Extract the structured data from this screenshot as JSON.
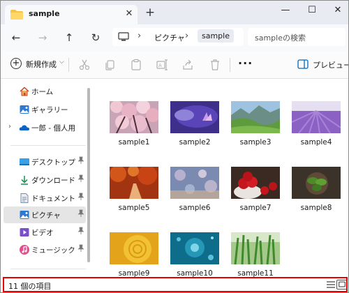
{
  "tab": {
    "title": "sample",
    "close_glyph": "✕",
    "new_tab_glyph": "+"
  },
  "window_controls": {
    "minimize": "—",
    "maximize": "☐",
    "close": "✕"
  },
  "nav": {
    "back": "←",
    "forward": "→",
    "up": "↑",
    "refresh": "↻"
  },
  "address": {
    "separator": "›",
    "crumbs": [
      "ピクチャ",
      "sample"
    ]
  },
  "search": {
    "placeholder": "sampleの検索"
  },
  "toolbar": {
    "new_label": "新規作成",
    "new_caret": "⌵",
    "more": "···",
    "preview_label": "プレビュー",
    "icons": [
      "cut-icon",
      "copy-icon",
      "paste-icon",
      "rename-icon",
      "share-icon",
      "delete-icon"
    ]
  },
  "sidebar": {
    "items": [
      {
        "label": "ホーム",
        "icon": "home-icon"
      },
      {
        "label": "ギャラリー",
        "icon": "gallery-icon"
      },
      {
        "label": "一郎 - 個人用",
        "icon": "onedrive-icon",
        "expander": "›"
      },
      {
        "label": "デスクトップ",
        "icon": "desktop-icon",
        "pinned": true
      },
      {
        "label": "ダウンロード",
        "icon": "download-icon",
        "pinned": true
      },
      {
        "label": "ドキュメント",
        "icon": "document-icon",
        "pinned": true
      },
      {
        "label": "ピクチャ",
        "icon": "pictures-icon",
        "pinned": true,
        "active": true
      },
      {
        "label": "ビデオ",
        "icon": "video-icon",
        "pinned": true
      },
      {
        "label": "ミュージック",
        "icon": "music-icon",
        "pinned": true
      }
    ]
  },
  "files": [
    {
      "name": "sample1"
    },
    {
      "name": "sample2"
    },
    {
      "name": "sample3"
    },
    {
      "name": "sample4"
    },
    {
      "name": "sample5"
    },
    {
      "name": "sample6"
    },
    {
      "name": "sample7"
    },
    {
      "name": "sample8"
    },
    {
      "name": "sample9"
    },
    {
      "name": "sample10"
    },
    {
      "name": "sample11"
    }
  ],
  "status": {
    "item_count": "11 個の項目"
  },
  "colors": {
    "highlight_border": "#e60000",
    "accent": "#0067c0",
    "tab_bar": "#e8ecf2"
  }
}
